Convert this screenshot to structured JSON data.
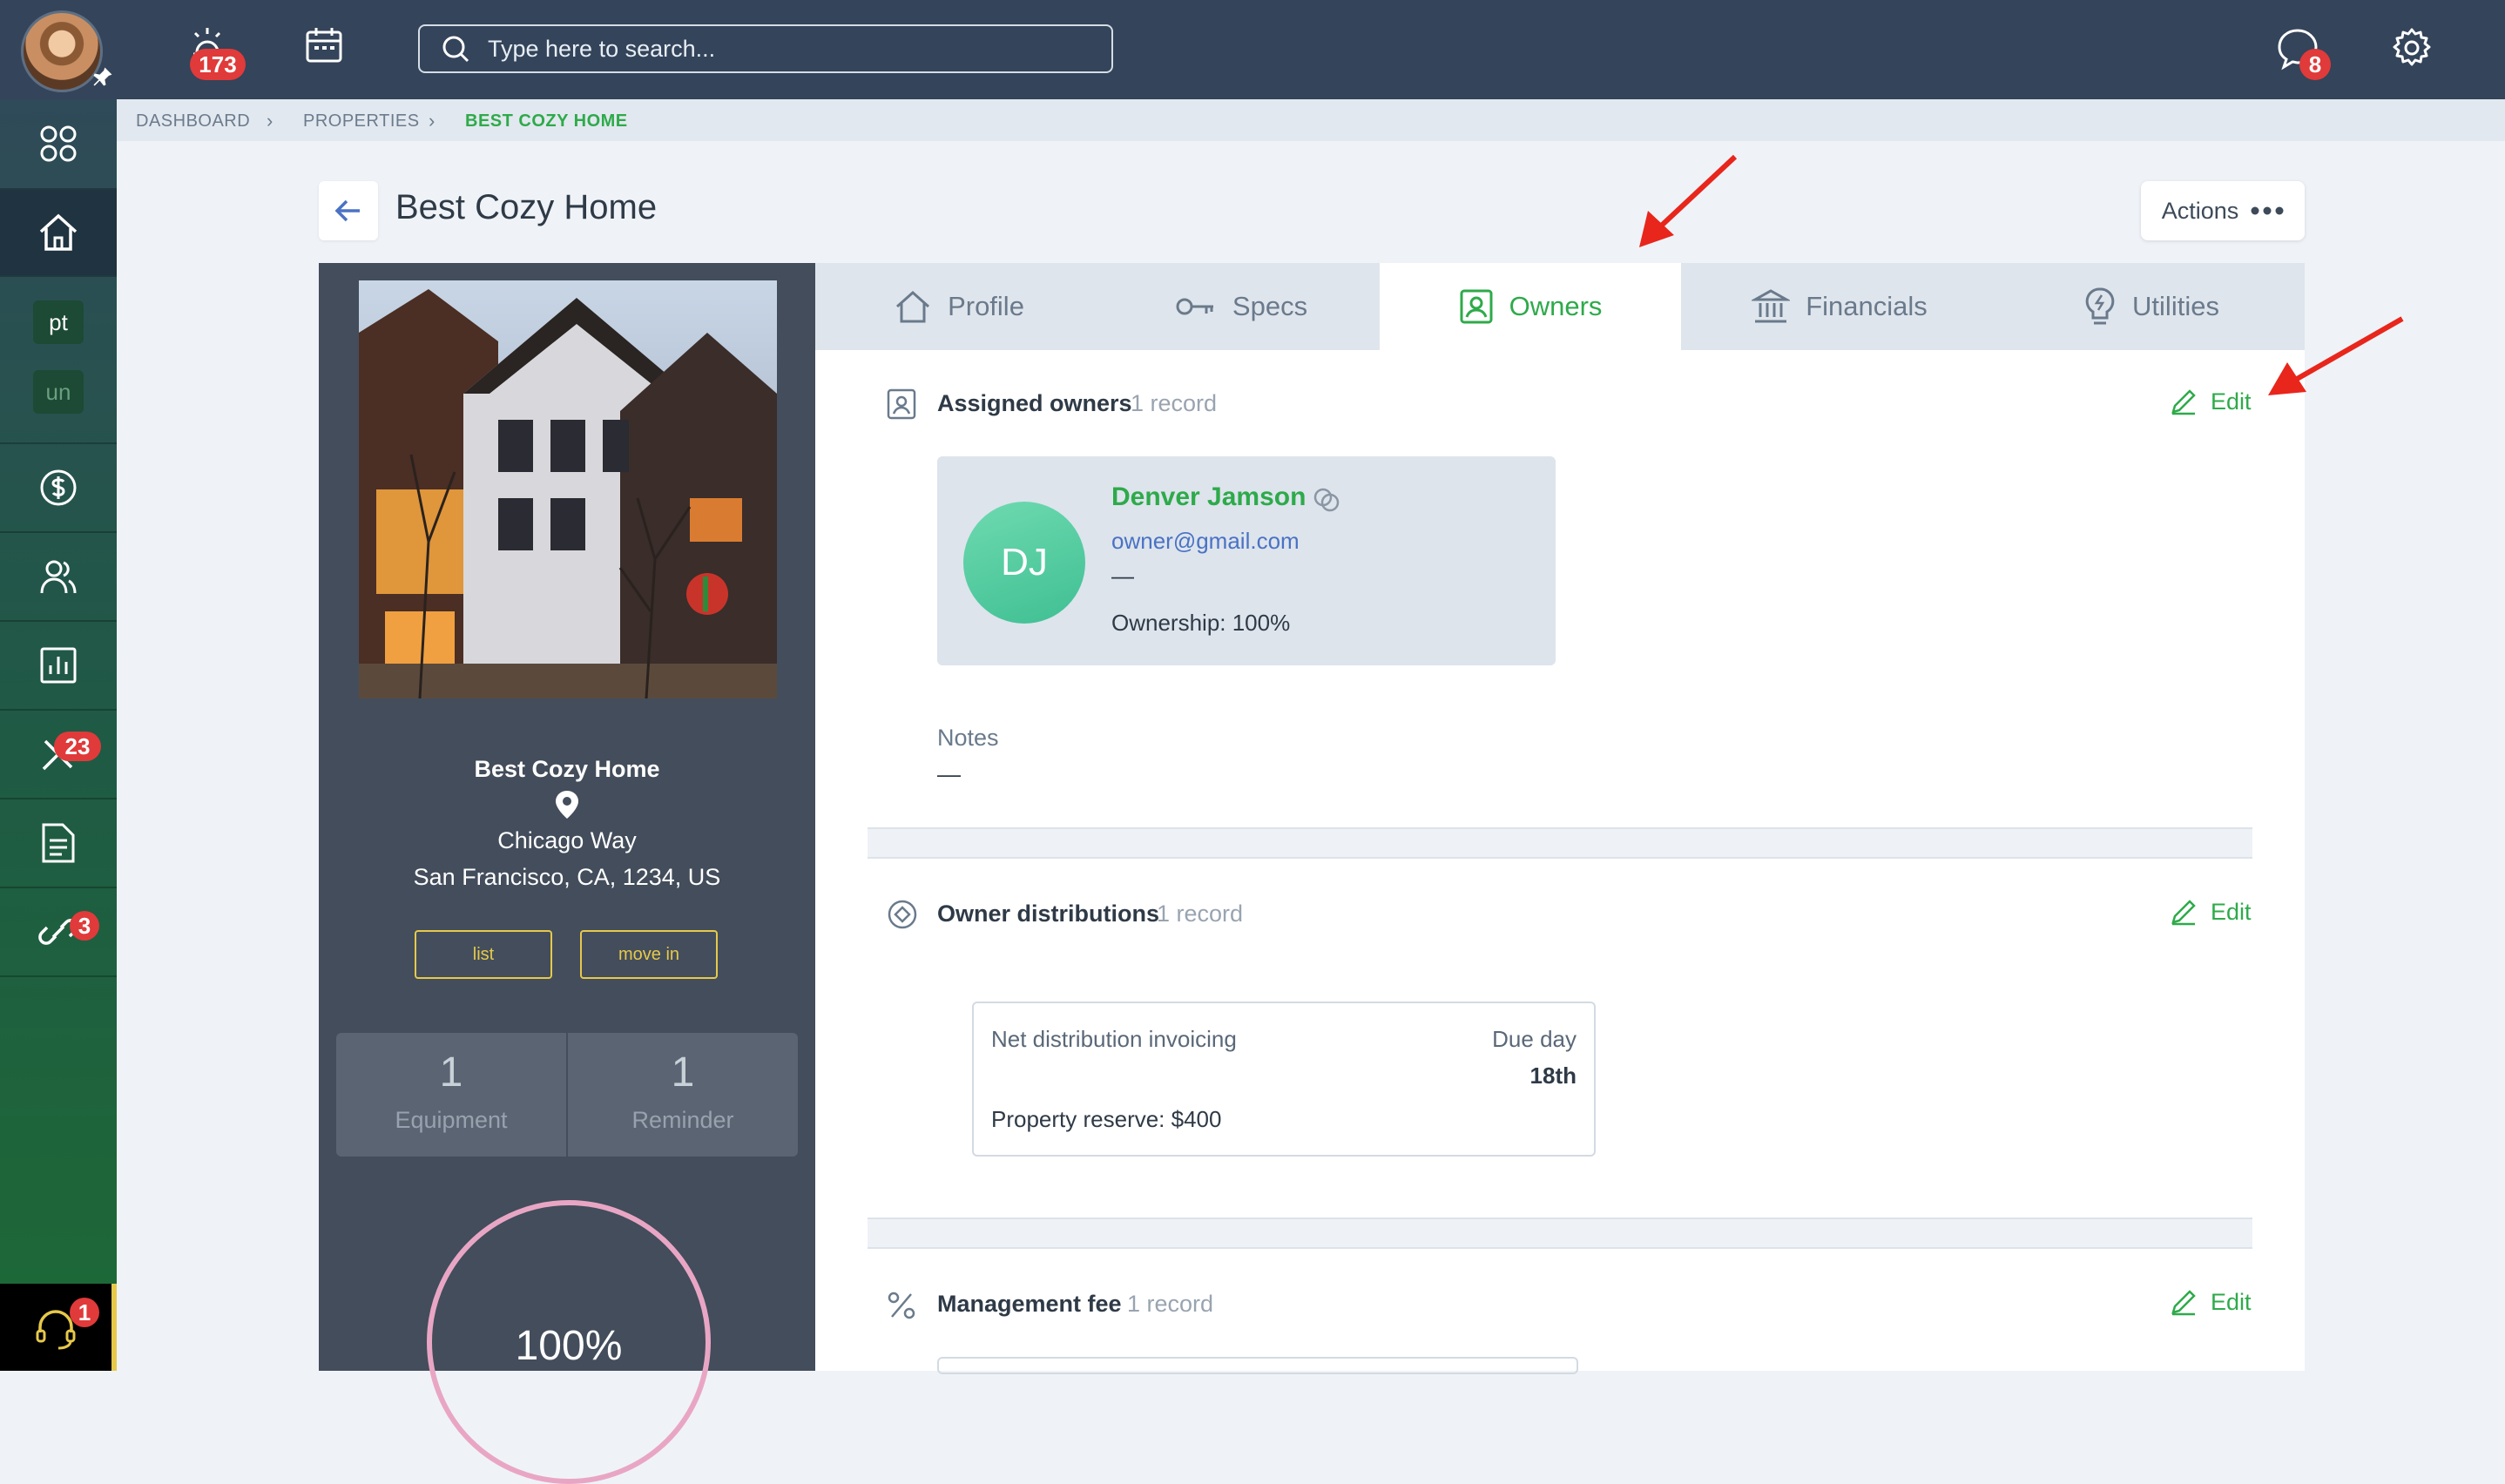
{
  "topbar": {
    "alerts_count": "173",
    "search_placeholder": "Type here to search...",
    "messages_count": "8"
  },
  "sidebar": {
    "tiles": [
      "pt",
      "un"
    ],
    "maintenance_count": "23",
    "tasks_count": "3",
    "support_count": "1"
  },
  "breadcrumb": {
    "items": [
      "DASHBOARD",
      "PROPERTIES",
      "BEST COZY HOME"
    ]
  },
  "header": {
    "title": "Best Cozy Home",
    "actions_label": "Actions"
  },
  "property": {
    "name": "Best Cozy Home",
    "street": "Chicago Way",
    "city_line": "San Francisco, CA, 1234, US",
    "buttons": [
      "list",
      "move in"
    ],
    "stats": [
      {
        "value": "1",
        "label": "Equipment"
      },
      {
        "value": "1",
        "label": "Reminder"
      }
    ],
    "occupancy": "100%"
  },
  "tabs": [
    {
      "label": "Profile",
      "icon": "house-icon"
    },
    {
      "label": "Specs",
      "icon": "key-icon"
    },
    {
      "label": "Owners",
      "icon": "owner-badge-icon",
      "active": true
    },
    {
      "label": "Financials",
      "icon": "bank-icon"
    },
    {
      "label": "Utilities",
      "icon": "bulb-icon"
    }
  ],
  "sections": {
    "assigned_owners": {
      "title": "Assigned owners",
      "count": "1 record",
      "edit": "Edit",
      "owner": {
        "initials": "DJ",
        "name": "Denver Jamson",
        "email": "owner@gmail.com",
        "phone": "—",
        "ownership": "Ownership: 100%"
      },
      "notes_label": "Notes",
      "notes_value": "—"
    },
    "owner_distributions": {
      "title": "Owner distributions",
      "count": "1 record",
      "edit": "Edit",
      "invoicing_label": "Net distribution invoicing",
      "due_label": "Due day",
      "due_value": "18th",
      "reserve": "Property reserve: $400"
    },
    "management_fee": {
      "title": "Management fee",
      "count": "1 record",
      "edit": "Edit"
    }
  },
  "colors": {
    "accent": "#2eaa4a",
    "topbar": "#34445a",
    "badge": "#e03a3a",
    "annotation_arrow": "#e8261c"
  }
}
